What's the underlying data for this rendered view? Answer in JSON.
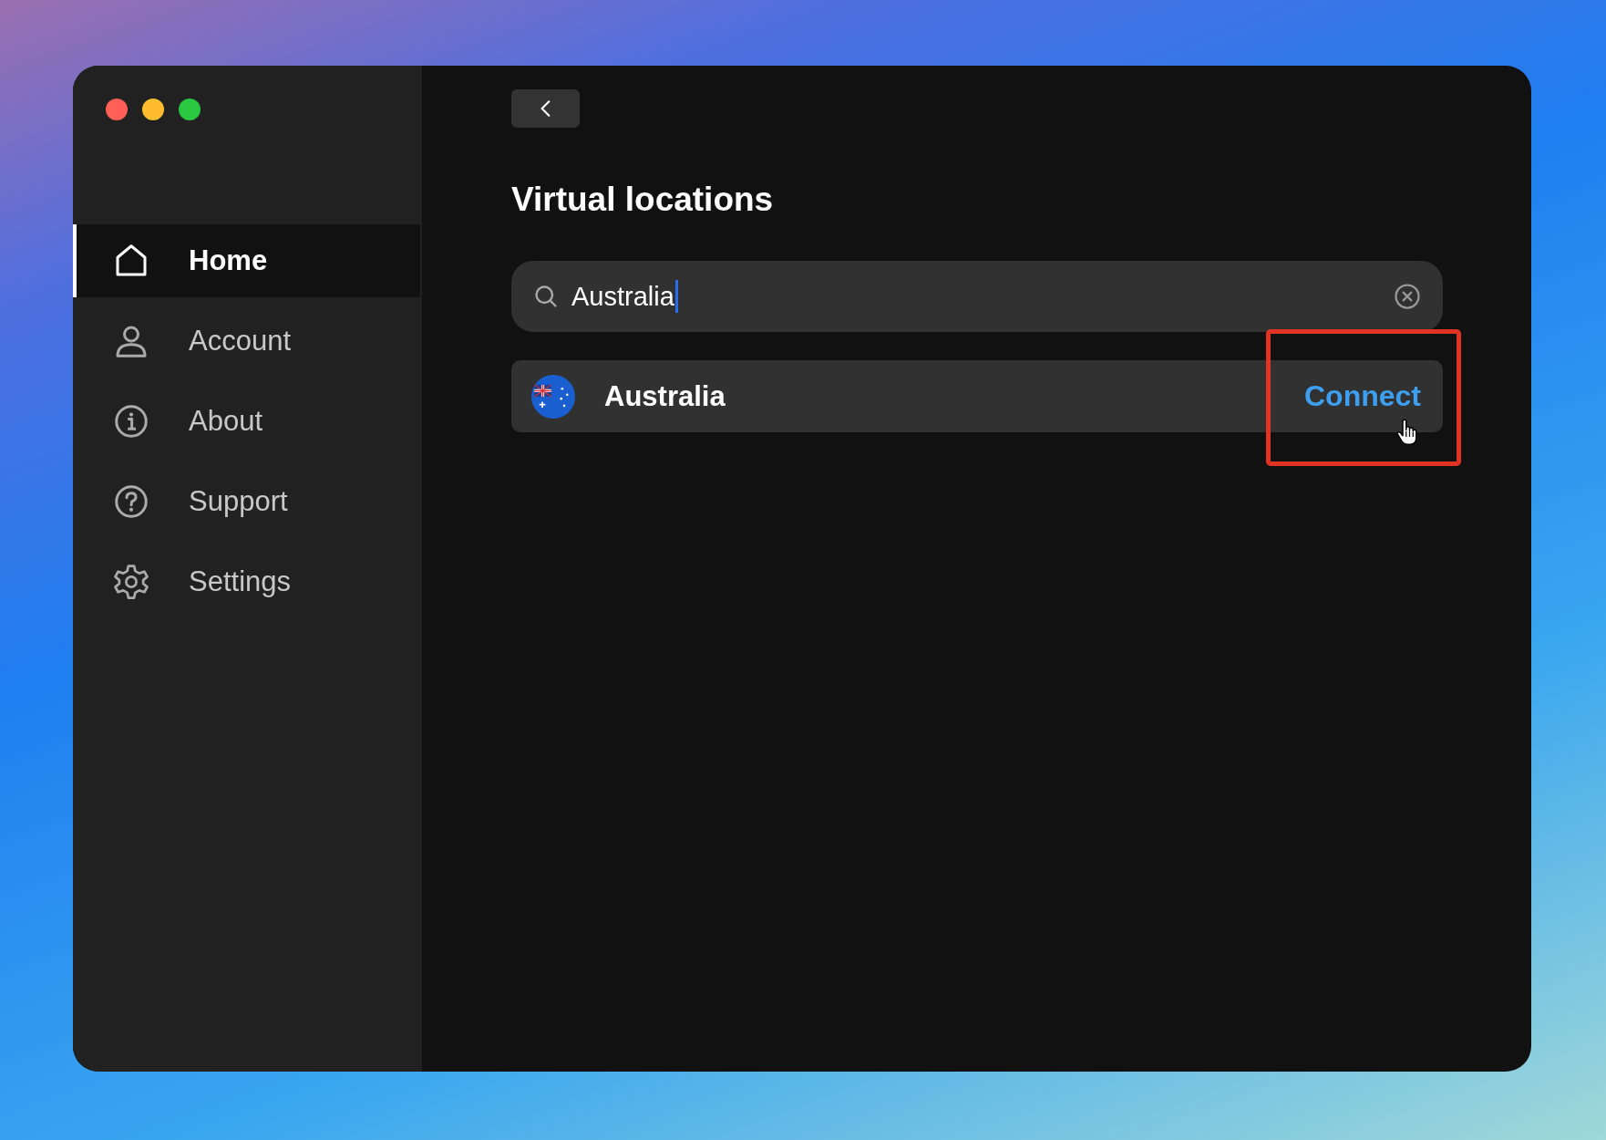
{
  "sidebar": {
    "items": [
      {
        "label": "Home",
        "selected": true
      },
      {
        "label": "Account",
        "selected": false
      },
      {
        "label": "About",
        "selected": false
      },
      {
        "label": "Support",
        "selected": false
      },
      {
        "label": "Settings",
        "selected": false
      }
    ]
  },
  "title": "Virtual locations",
  "search": {
    "value": "Australia",
    "focused": true
  },
  "results": [
    {
      "name": "Australia",
      "action": "Connect",
      "highlighted": true,
      "hovered": true
    }
  ]
}
